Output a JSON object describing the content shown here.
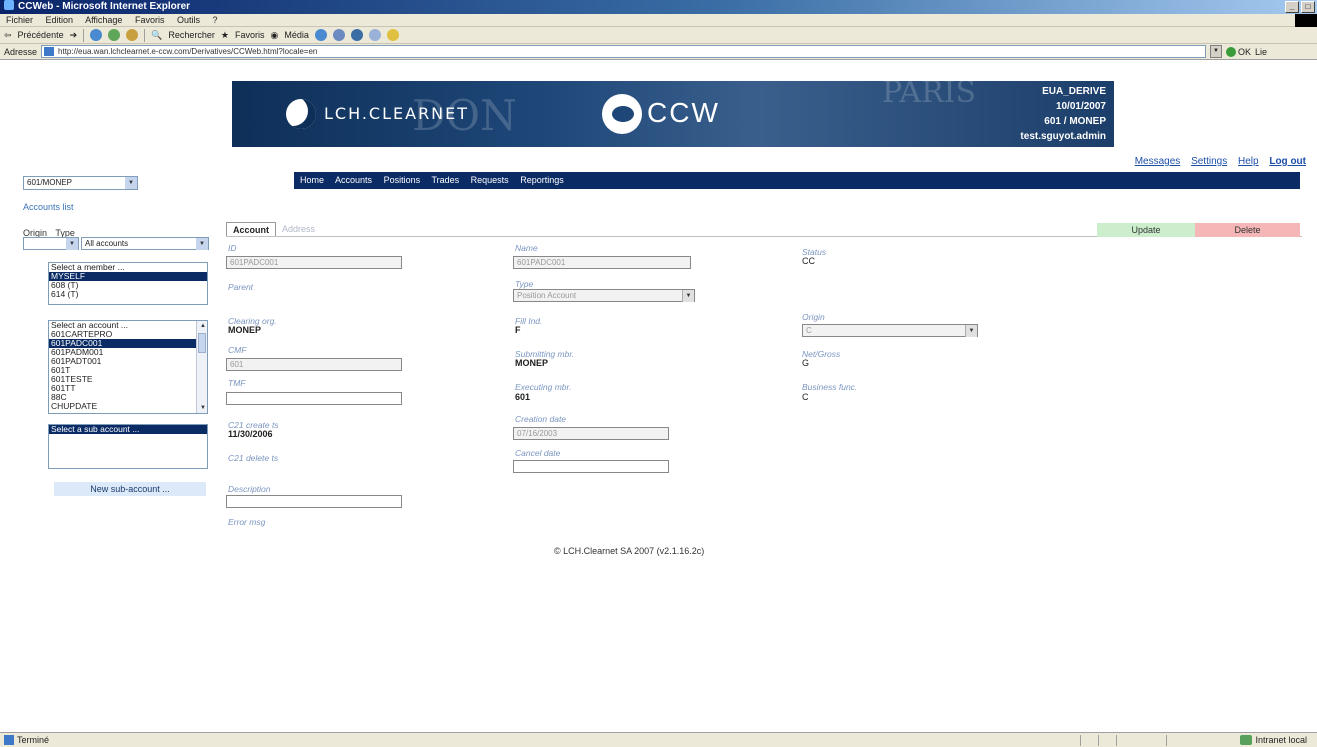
{
  "browser": {
    "title": "CCWeb - Microsoft Internet Explorer",
    "menu": [
      "Fichier",
      "Edition",
      "Affichage",
      "Favoris",
      "Outils",
      "?"
    ],
    "toolbar": {
      "back": "Précédente",
      "search": "Rechercher",
      "favorites": "Favoris",
      "media": "Média"
    },
    "address_label": "Adresse",
    "address": "http://eua.wan.lchclearnet.e-ccw.com/Derivatives/CCWeb.html?locale=en",
    "go_label": "OK",
    "links_label": "Lie",
    "status_left": "Terminé",
    "status_zone": "Intranet local"
  },
  "banner": {
    "brand": "LCH.CLEARNET",
    "app": "CCW",
    "env": "EUA_DERIVE",
    "date": "10/01/2007",
    "member": "601 / MONEP",
    "user": "test.sguyot.admin"
  },
  "top_links": {
    "messages": "Messages",
    "settings": "Settings",
    "help": "Help",
    "logout": "Log out"
  },
  "member_select": "601/MONEP",
  "nav": [
    "Home",
    "Accounts",
    "Positions",
    "Trades",
    "Requests",
    "Reportings"
  ],
  "breadcrumb": "Accounts list",
  "left": {
    "origin_label": "Origin",
    "type_label": "Type",
    "type_value": "All accounts",
    "members": [
      "Select a member ...",
      "MYSELF",
      "608 (T)",
      "614 (T)"
    ],
    "member_selected": 1,
    "accounts": [
      "Select an account ...",
      "601CARTEPRO",
      "601PADC001",
      "601PADM001",
      "601PADT001",
      "601T",
      "601TESTE",
      "601TT",
      "88C",
      "CHUPDATE"
    ],
    "account_selected": 2,
    "subaccounts": [
      "Select a sub account ..."
    ],
    "subaccount_selected": 0,
    "new_sub_account": "New sub-account ..."
  },
  "tabs": {
    "account": "Account",
    "address": "Address"
  },
  "actions": {
    "update": "Update",
    "delete": "Delete"
  },
  "form": {
    "id_label": "ID",
    "id_value": "601PADC001",
    "name_label": "Name",
    "name_value": "601PADC001",
    "status_label": "Status",
    "status_value": "CC",
    "parent_label": "Parent",
    "type_label": "Type",
    "type_value": "Position Account",
    "clearing_org_label": "Clearing org.",
    "clearing_org_value": "MONEP",
    "fill_ind_label": "Fill Ind.",
    "fill_ind_value": "F",
    "origin_label": "Origin",
    "origin_value": "C",
    "cmf_label": "CMF",
    "cmf_value": "601",
    "submitting_mbr_label": "Submitting mbr.",
    "submitting_mbr_value": "MONEP",
    "net_gross_label": "Net/Gross",
    "net_gross_value": "G",
    "tmf_label": "TMF",
    "tmf_value": "",
    "executing_mbr_label": "Executing mbr.",
    "executing_mbr_value": "601",
    "business_func_label": "Business func.",
    "business_func_value": "C",
    "c21_create_label": "C21 create ts",
    "c21_create_value": "11/30/2006",
    "creation_date_label": "Creation date",
    "creation_date_value": "07/16/2003",
    "c21_delete_label": "C21 delete ts",
    "cancel_date_label": "Cancel date",
    "cancel_date_value": "",
    "description_label": "Description",
    "description_value": "",
    "error_msg_label": "Error msg"
  },
  "footer": "© LCH.Clearnet SA 2007 (v2.1.16.2c)"
}
